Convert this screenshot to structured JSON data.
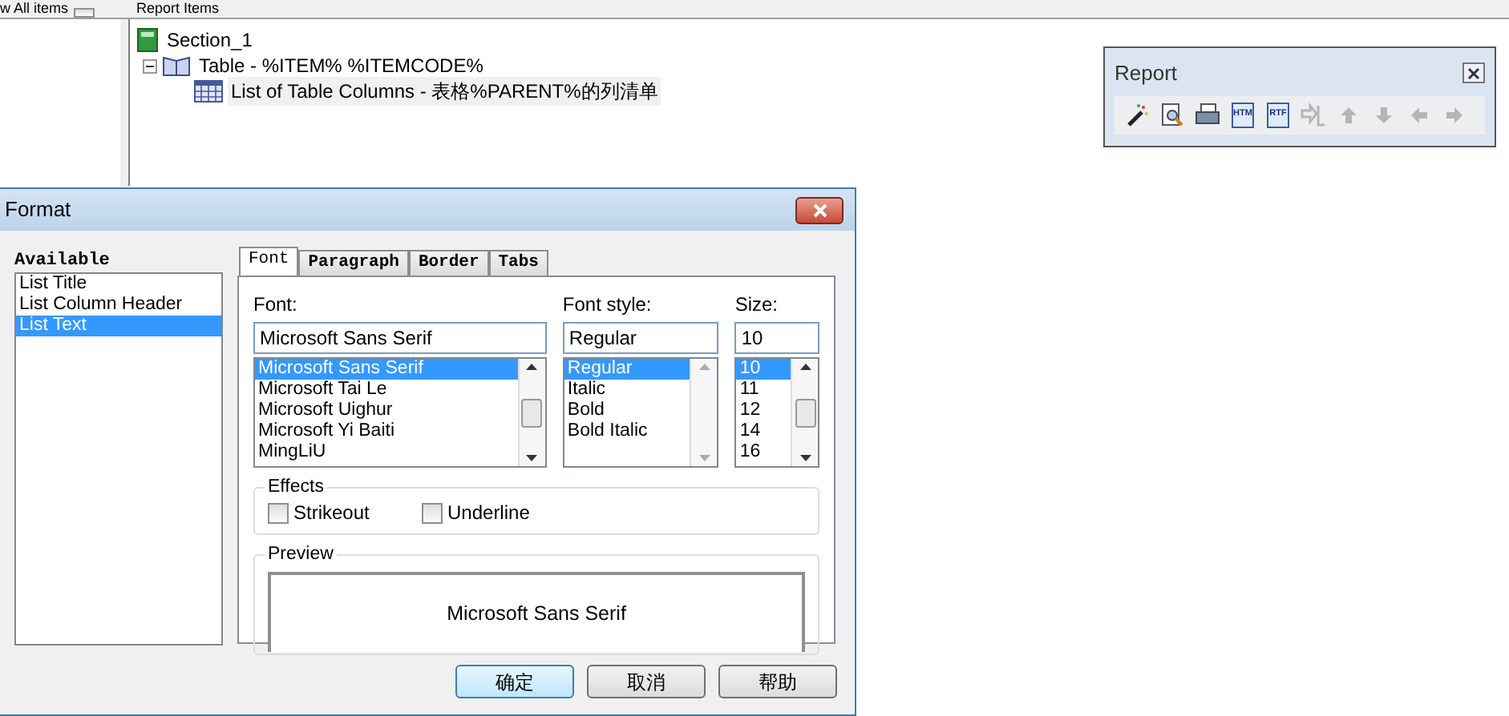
{
  "header": {
    "checkbox_label": "w All items",
    "checked": false,
    "panel_title": "Report Items"
  },
  "tree": [
    {
      "label": "Section_1",
      "kind": "section",
      "selected": false,
      "children": [
        {
          "label": "Table - %ITEM% %ITEMCODE%",
          "kind": "table",
          "selected": false,
          "expanded": true,
          "children": [
            {
              "label": "List of Table Columns - 表格%PARENT%的列清单",
              "kind": "list",
              "selected": true
            }
          ]
        }
      ]
    }
  ],
  "report_toolbar": {
    "title": "Report",
    "buttons": [
      {
        "kind": "wand",
        "disabled": false
      },
      {
        "kind": "preview",
        "disabled": false
      },
      {
        "kind": "print",
        "disabled": false
      },
      {
        "kind": "doc",
        "label": "HTM",
        "disabled": false
      },
      {
        "kind": "doc",
        "label": "RTF",
        "disabled": false
      },
      {
        "kind": "tree",
        "disabled": true
      },
      {
        "kind": "up",
        "disabled": true
      },
      {
        "kind": "down",
        "disabled": true
      },
      {
        "kind": "left",
        "disabled": true
      },
      {
        "kind": "right",
        "disabled": true
      }
    ]
  },
  "dialog": {
    "title": "Format",
    "available": {
      "label": "Available",
      "items": [
        {
          "label": "List Title",
          "selected": false
        },
        {
          "label": "List Column Header",
          "selected": false
        },
        {
          "label": "List Text",
          "selected": true
        }
      ]
    },
    "tabs": [
      {
        "label": "Font",
        "selected": true
      },
      {
        "label": "Paragraph",
        "selected": false
      },
      {
        "label": "Border",
        "selected": false
      },
      {
        "label": "Tabs",
        "selected": false
      }
    ],
    "pickers": [
      {
        "label": "Font:",
        "value": "Microsoft Sans Serif",
        "options": [
          {
            "label": "Microsoft Sans Serif",
            "selected": true
          },
          {
            "label": "Microsoft Tai Le",
            "selected": false
          },
          {
            "label": "Microsoft Uighur",
            "selected": false
          },
          {
            "label": "Microsoft Yi Baiti",
            "selected": false
          },
          {
            "label": "MingLiU",
            "selected": false
          }
        ],
        "scroll_enabled": true
      },
      {
        "label": "Font style:",
        "value": "Regular",
        "options": [
          {
            "label": "Regular",
            "selected": true
          },
          {
            "label": "Italic",
            "selected": false
          },
          {
            "label": "Bold",
            "selected": false
          },
          {
            "label": "Bold Italic",
            "selected": false
          }
        ],
        "scroll_enabled": false
      },
      {
        "label": "Size:",
        "value": "10",
        "options": [
          {
            "label": "10",
            "selected": true
          },
          {
            "label": "11",
            "selected": false
          },
          {
            "label": "12",
            "selected": false
          },
          {
            "label": "14",
            "selected": false
          },
          {
            "label": "16",
            "selected": false
          }
        ],
        "scroll_enabled": true
      }
    ],
    "effects": {
      "title": "Effects",
      "options": [
        {
          "label": "Strikeout",
          "checked": false
        },
        {
          "label": "Underline",
          "checked": false
        }
      ]
    },
    "preview": {
      "title": "Preview",
      "text": "Microsoft Sans Serif"
    },
    "buttons": [
      {
        "label": "确定",
        "default": true
      },
      {
        "label": "取消",
        "default": false
      },
      {
        "label": "帮助",
        "default": false
      }
    ]
  }
}
